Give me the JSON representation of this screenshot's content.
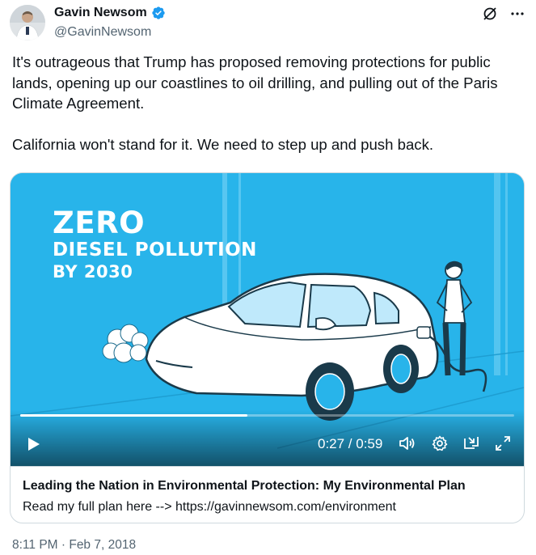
{
  "author": {
    "display_name": "Gavin Newsom",
    "handle": "@GavinNewsom",
    "verified": true,
    "avatar_icon": "avatar-photo"
  },
  "header_actions": [
    {
      "name": "grok-icon"
    },
    {
      "name": "more-icon",
      "label": "···"
    }
  ],
  "tweet": {
    "text": "It's outrageous that Trump has proposed removing protections for public lands, opening up our coastlines to oil drilling, and pulling out of the Paris Climate Agreement.\n\nCalifornia won't stand for it. We need to step up and push back.",
    "timestamp": "8:11 PM · Feb 7, 2018"
  },
  "video": {
    "overlay_line1": "ZERO",
    "overlay_line2": "DIESEL POLLUTION",
    "overlay_line3": "BY 2030",
    "time_display": "0:27 / 0:59",
    "progress_fraction": 0.46,
    "bg_color": "#28b4ea"
  },
  "card": {
    "title": "Leading the Nation in Environmental Protection: My Environmental Plan",
    "description": "Read my full plan here --> https://gavinnewsom.com/environment"
  },
  "colors": {
    "text": "#0f1419",
    "secondary": "#536471",
    "verified": "#1d9bf0",
    "border": "#cfd9de"
  }
}
